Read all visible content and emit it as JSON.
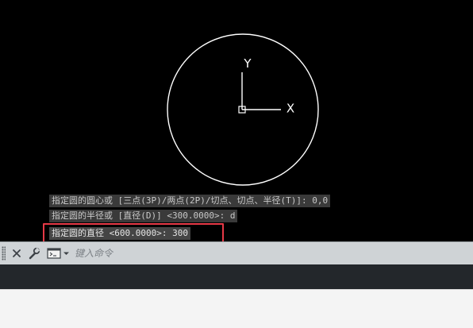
{
  "drawing": {
    "axis_x_label": "X",
    "axis_y_label": "Y"
  },
  "command_history": [
    "指定圆的圆心或 [三点(3P)/两点(2P)/切点、切点、半径(T)]: 0,0",
    "指定圆的半径或 [直径(D)] <300.0000>: d",
    "指定圆的直径 <600.0000>: 300"
  ],
  "command_line": {
    "placeholder": "键入命令"
  },
  "colors": {
    "canvas_background": "#000000",
    "geometry_stroke": "#ffffff",
    "highlight_border": "#e63946",
    "command_bar": "#cfd3d6"
  },
  "icons": {
    "grip": "grip-icon",
    "close": "close-icon",
    "settings": "wrench-icon",
    "prompt": "command-prompt-icon",
    "dropdown": "chevron-down-icon"
  }
}
